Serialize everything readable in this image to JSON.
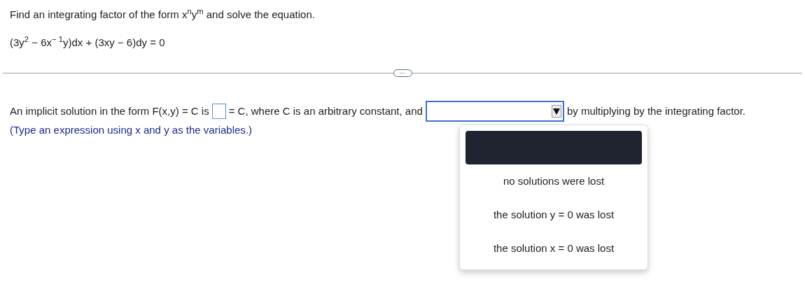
{
  "question": {
    "prompt": "Find an integrating factor of the form x$^{n}$y$^{m}$ and solve the equation.",
    "equation": "(3y$^{2}$ − 6x$^{− 1}$y)dx + (3xy − 6)dy = 0"
  },
  "divider": {
    "button": "···"
  },
  "answer": {
    "text_before": "An implicit solution in the form F(x,y) = C is",
    "text_middle": "= C, where C is an arbitrary constant, and",
    "text_after": "by multiplying by the integrating factor.",
    "hint": "(Type an expression using x and y as the variables.)",
    "dropdown": {
      "expanded": true,
      "blank_option_highlighted": true,
      "options": [
        {
          "label": "no solutions were lost",
          "selected": false
        },
        {
          "label": "the solution y = 0 was lost",
          "selected": false
        },
        {
          "label": "the solution x = 0 was lost",
          "selected": false
        }
      ]
    }
  }
}
